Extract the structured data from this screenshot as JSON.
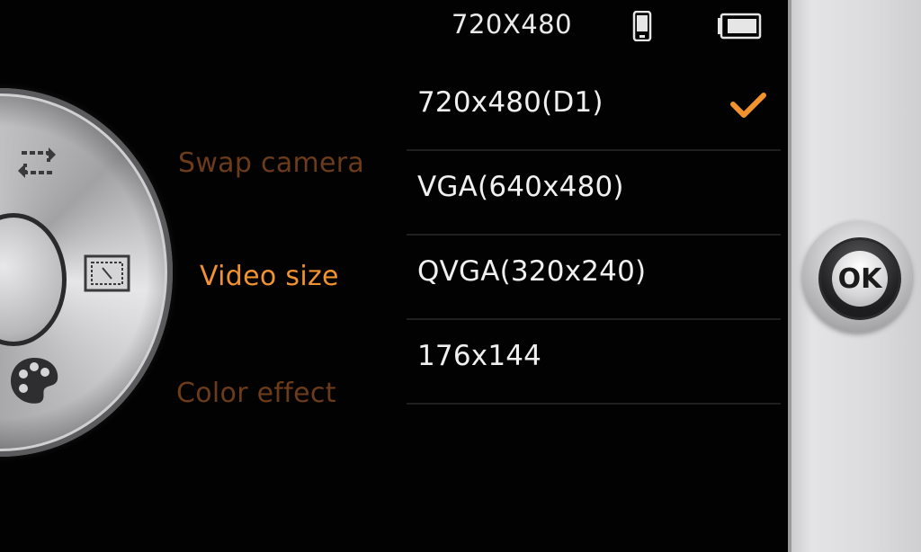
{
  "status_bar": {
    "resolution": "720X480",
    "icons": [
      "phone-icon",
      "battery-icon"
    ]
  },
  "dial": {
    "icons": [
      "swap-camera-icon",
      "video-size-icon",
      "color-effect-icon"
    ]
  },
  "menu": {
    "items": [
      {
        "label": "Swap camera",
        "state": "dimmed"
      },
      {
        "label": "Video size",
        "state": "selected"
      },
      {
        "label": "Color effect",
        "state": "dimmed"
      }
    ]
  },
  "options": [
    {
      "label": "720x480(D1)",
      "checked": true
    },
    {
      "label": "VGA(640x480)",
      "checked": false
    },
    {
      "label": "QVGA(320x240)",
      "checked": false
    },
    {
      "label": "176x144",
      "checked": false
    }
  ],
  "ok_button": {
    "label": "OK"
  },
  "colors": {
    "accent": "#f0922e",
    "dimmed_label": "#6b3b1a",
    "background": "#020202",
    "option_text": "#f0f0f0"
  }
}
